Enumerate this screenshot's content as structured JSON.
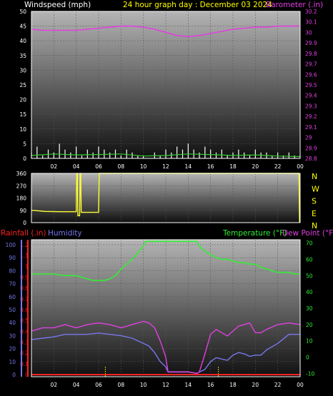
{
  "header": {
    "left_label": "Windspeed (mph)",
    "center_label": "24 hour graph day : December 03 2024",
    "right_label": "Barometer (.in)"
  },
  "colors": {
    "windspeed": "#ffffff",
    "wind_gust": "#ffffff",
    "wind_avg": "#33cc33",
    "barometer": "#e040e0",
    "direction": "#ffff33",
    "temperature": "#33ee33",
    "dew_point": "#e040e0",
    "humidity": "#7777ee",
    "rainfall": "#ff2222",
    "header_yellow": "#ffff00",
    "text_white": "#ffffff"
  },
  "chart_data": [
    {
      "type": "line",
      "title": "24 hour graph day : December 03 2024",
      "x": {
        "ticks": [
          "02",
          "04",
          "06",
          "08",
          "10",
          "12",
          "14",
          "16",
          "18",
          "20",
          "22",
          "00"
        ],
        "range_hours": [
          0,
          24
        ]
      },
      "y_left": {
        "label": "Windspeed (mph)",
        "ticks": [
          0,
          5,
          10,
          15,
          20,
          25,
          30,
          35,
          40,
          45,
          50
        ],
        "ylim": [
          0,
          50
        ]
      },
      "y_right": {
        "label": "Barometer (.in)",
        "ticks": [
          28.8,
          28.9,
          29.0,
          29.1,
          29.2,
          29.3,
          29.4,
          29.5,
          29.6,
          29.7,
          29.8,
          29.9,
          30.0,
          30.1,
          30.2
        ],
        "tick_labels": [
          "28.8",
          "28.9",
          "29",
          "29.1",
          "29.2",
          "29.3",
          "29.4",
          "29.5",
          "29.6",
          "29.7",
          "29.8",
          "29.9",
          "30",
          "30.1",
          "30.2"
        ],
        "ylim": [
          28.8,
          30.2
        ]
      },
      "series": [
        {
          "axis": "right",
          "x": [
            0,
            1,
            2,
            3,
            4,
            5,
            6,
            7,
            8,
            9,
            10,
            11,
            12,
            13,
            14,
            15,
            16,
            17,
            18,
            19,
            20,
            21,
            22,
            23,
            24
          ],
          "values": [
            30.03,
            30.02,
            30.02,
            30.02,
            30.02,
            30.03,
            30.04,
            30.05,
            30.06,
            30.06,
            30.05,
            30.03,
            30.0,
            29.97,
            29.96,
            29.97,
            29.99,
            30.01,
            30.03,
            30.04,
            30.05,
            30.05,
            30.06,
            30.06,
            30.06
          ]
        },
        {
          "axis": "left",
          "x": [
            0,
            0.5,
            1,
            1.5,
            2,
            2.5,
            3,
            3.5,
            4,
            4.5,
            5,
            5.5,
            6,
            6.5,
            7,
            7.5,
            8,
            8.5,
            9,
            9.5,
            10,
            10.5,
            11,
            11.5,
            12,
            12.5,
            13,
            13.5,
            14,
            14.5,
            15,
            15.5,
            16,
            16.5,
            17,
            17.5,
            18,
            18.5,
            19,
            19.5,
            20,
            20.5,
            21,
            21.5,
            22,
            22.5,
            23,
            23.5,
            24
          ],
          "values": [
            2,
            4,
            1,
            3,
            2,
            5,
            3,
            2,
            4,
            1,
            3,
            2,
            4,
            3,
            2,
            3,
            1,
            3,
            2,
            1,
            1,
            0,
            2,
            1,
            3,
            2,
            4,
            3,
            5,
            3,
            2,
            4,
            3,
            2,
            3,
            1,
            2,
            3,
            2,
            1,
            3,
            2,
            2,
            1,
            2,
            1,
            2,
            1,
            1
          ]
        },
        {
          "axis": "left",
          "x": [
            0,
            2,
            4,
            6,
            8,
            10,
            12,
            14,
            16,
            18,
            20,
            22,
            24
          ],
          "values": [
            1,
            1.5,
            1.2,
            1.3,
            1.5,
            0.8,
            1,
            1.5,
            1.3,
            1,
            1.2,
            0.8,
            0.6
          ]
        }
      ]
    },
    {
      "type": "line",
      "y": {
        "ticks": [
          0,
          90,
          180,
          270,
          360
        ],
        "ylim": [
          0,
          360
        ]
      },
      "y_right_labels": [
        "N",
        "W",
        "S",
        "E",
        "N"
      ],
      "x": {
        "range_hours": [
          0,
          24
        ]
      },
      "series": [
        {
          "x": [
            0,
            0.2,
            1.2,
            2.5,
            4.0,
            4.05,
            4.1,
            4.15,
            4.3,
            4.35,
            4.4,
            4.45,
            6.0,
            6.05,
            6.1,
            6.15,
            23.9,
            23.95,
            24
          ],
          "values": [
            90,
            90,
            82,
            80,
            80,
            360,
            360,
            50,
            50,
            360,
            360,
            75,
            75,
            360,
            360,
            360,
            360,
            5,
            5
          ]
        }
      ]
    },
    {
      "type": "line",
      "labels": {
        "rainfall": "Rainfall (.in)",
        "humidity": "Humidity",
        "temperature": "Temperature (°F)",
        "dew_point": "Dew Point (°F)"
      },
      "x": {
        "ticks": [
          "02",
          "04",
          "06",
          "08",
          "10",
          "12",
          "14",
          "16",
          "18",
          "20",
          "22",
          "00"
        ],
        "range_hours": [
          0,
          24
        ]
      },
      "y_humidity": {
        "ticks": [
          0,
          10,
          20,
          30,
          40,
          50,
          60,
          70,
          80,
          90,
          100
        ],
        "ylim": [
          0,
          100
        ]
      },
      "y_rainfall": {
        "ticks": [
          0,
          0.1,
          0.2,
          0.3,
          0.4,
          0.5,
          0.6,
          0.7,
          0.8,
          0.9,
          1,
          1.1,
          1.2
        ],
        "tick_labels": [
          "0",
          "0.1",
          "0.2",
          "0.3",
          "0.4",
          "0.5",
          "0.6",
          "0.7",
          "0.8",
          "0.9",
          "1",
          "1.1",
          "1.2"
        ],
        "ylim": [
          0,
          1.2
        ]
      },
      "y_temperature": {
        "ticks": [
          -10,
          0,
          10,
          20,
          30,
          40,
          50,
          60,
          70
        ],
        "ylim": [
          -12,
          72
        ]
      },
      "series": [
        {
          "key": "temperature",
          "x": [
            0,
            1,
            2,
            3,
            4,
            4.5,
            5,
            5.5,
            6,
            6.5,
            7,
            7.5,
            8,
            8.5,
            9,
            9.5,
            10,
            10.2,
            14.8,
            15,
            15.5,
            16,
            16.5,
            17,
            17.5,
            18,
            18.5,
            19,
            19.5,
            20,
            20.5,
            21,
            21.5,
            22,
            22.5,
            23,
            23.5,
            24
          ],
          "values": [
            51,
            51,
            51,
            50,
            50,
            49,
            48,
            47,
            47,
            47,
            48,
            50,
            54,
            57,
            60,
            64,
            68,
            71,
            71,
            68,
            65,
            63,
            61,
            60,
            60,
            59,
            58,
            58,
            57,
            57,
            55,
            54,
            53,
            52,
            52,
            52,
            51,
            51
          ]
        },
        {
          "key": "dew_point",
          "x": [
            0,
            0.5,
            1,
            2,
            3,
            4,
            5,
            6,
            7,
            7.5,
            8,
            9,
            10,
            10.5,
            11,
            11.5,
            12,
            12.2,
            13,
            14,
            14.8,
            15,
            15.5,
            16,
            16.5,
            17,
            17.5,
            18,
            18.5,
            19,
            19.5,
            20,
            20.5,
            21,
            22,
            23,
            24
          ],
          "values": [
            16,
            17,
            18,
            18,
            20,
            18,
            20,
            21,
            20,
            19,
            18,
            20,
            22,
            21,
            18,
            10,
            0,
            -9,
            -9,
            -9,
            -10,
            -9,
            2,
            14,
            17,
            15,
            13,
            16,
            19,
            20,
            21,
            15,
            15,
            17,
            20,
            21,
            20
          ]
        },
        {
          "key": "humidity",
          "x": [
            0,
            1,
            2,
            3,
            4,
            5,
            6,
            7,
            8,
            9,
            10,
            10.5,
            11,
            11.5,
            12,
            12.2,
            13,
            14,
            14.8,
            15,
            15.5,
            16,
            16.5,
            17,
            17.5,
            18,
            18.5,
            19,
            19.5,
            20,
            20.5,
            21,
            22,
            23,
            24
          ],
          "values": [
            27,
            28,
            29,
            31,
            31,
            31,
            32,
            31,
            30,
            28,
            24,
            22,
            17,
            10,
            6,
            2,
            2,
            2,
            1,
            2,
            4,
            10,
            13,
            12,
            11,
            15,
            17,
            16,
            14,
            15,
            15,
            19,
            24,
            31,
            31
          ]
        },
        {
          "key": "rainfall",
          "x": [
            0,
            24
          ],
          "values": [
            0,
            0
          ]
        }
      ],
      "markers": [
        {
          "x": 6.6
        },
        {
          "x": 16.7
        }
      ]
    }
  ]
}
